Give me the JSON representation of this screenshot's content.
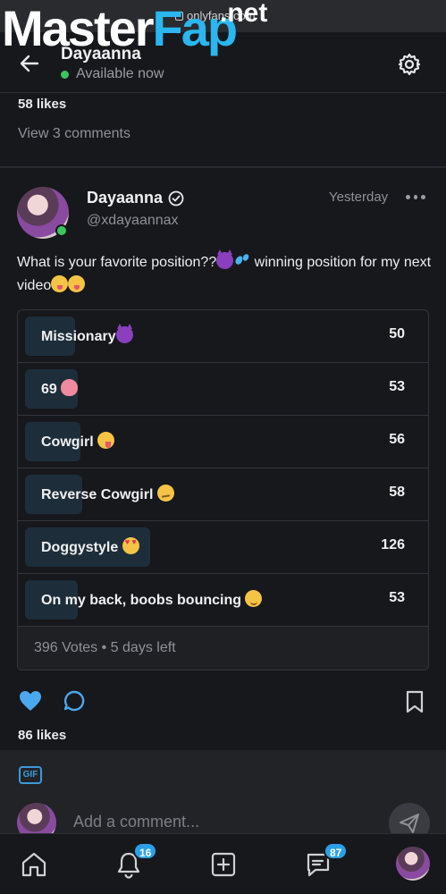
{
  "browser": {
    "url": "onlyfans.com"
  },
  "watermark": {
    "brand_left": "Master",
    "brand_right": "Fap",
    "brand_suffix": ".net"
  },
  "header": {
    "name": "Dayaanna",
    "status": "Available now"
  },
  "previous_post": {
    "likes": "58 likes",
    "comments_link": "View 3 comments"
  },
  "post": {
    "author_name": "Dayaanna",
    "handle": "@xdayaannax",
    "time": "Yesterday",
    "text_part1": "What is your favorite position??",
    "text_part2": " winning position for my next video",
    "poll": {
      "options": [
        {
          "label": "Missionary",
          "emoji": "smiling-devil",
          "votes": "50",
          "fraction": 0.4
        },
        {
          "label": "69 ",
          "emoji": "peach",
          "votes": "53",
          "fraction": 0.42
        },
        {
          "label": "Cowgirl ",
          "emoji": "zany-face",
          "votes": "56",
          "fraction": 0.44
        },
        {
          "label": "Reverse Cowgirl ",
          "emoji": "smirking-face",
          "votes": "58",
          "fraction": 0.46
        },
        {
          "label": "Doggystyle ",
          "emoji": "heart-eyes",
          "votes": "126",
          "fraction": 1.0
        },
        {
          "label": "On my back, boobs bouncing ",
          "emoji": "winking-face",
          "votes": "53",
          "fraction": 0.42
        }
      ],
      "total_votes": "396 Votes",
      "separator": " • ",
      "time_left": "5 days left"
    },
    "likes": "86 likes"
  },
  "composer": {
    "gif_label": "GIF",
    "placeholder": "Add a comment..."
  },
  "bottom_nav": {
    "notifications_badge": "16",
    "messages_badge": "87"
  },
  "colors": {
    "accent": "#2aa0e8",
    "online": "#3cc45e",
    "poll_fill": "#1d2e3a",
    "background": "#17181c"
  }
}
